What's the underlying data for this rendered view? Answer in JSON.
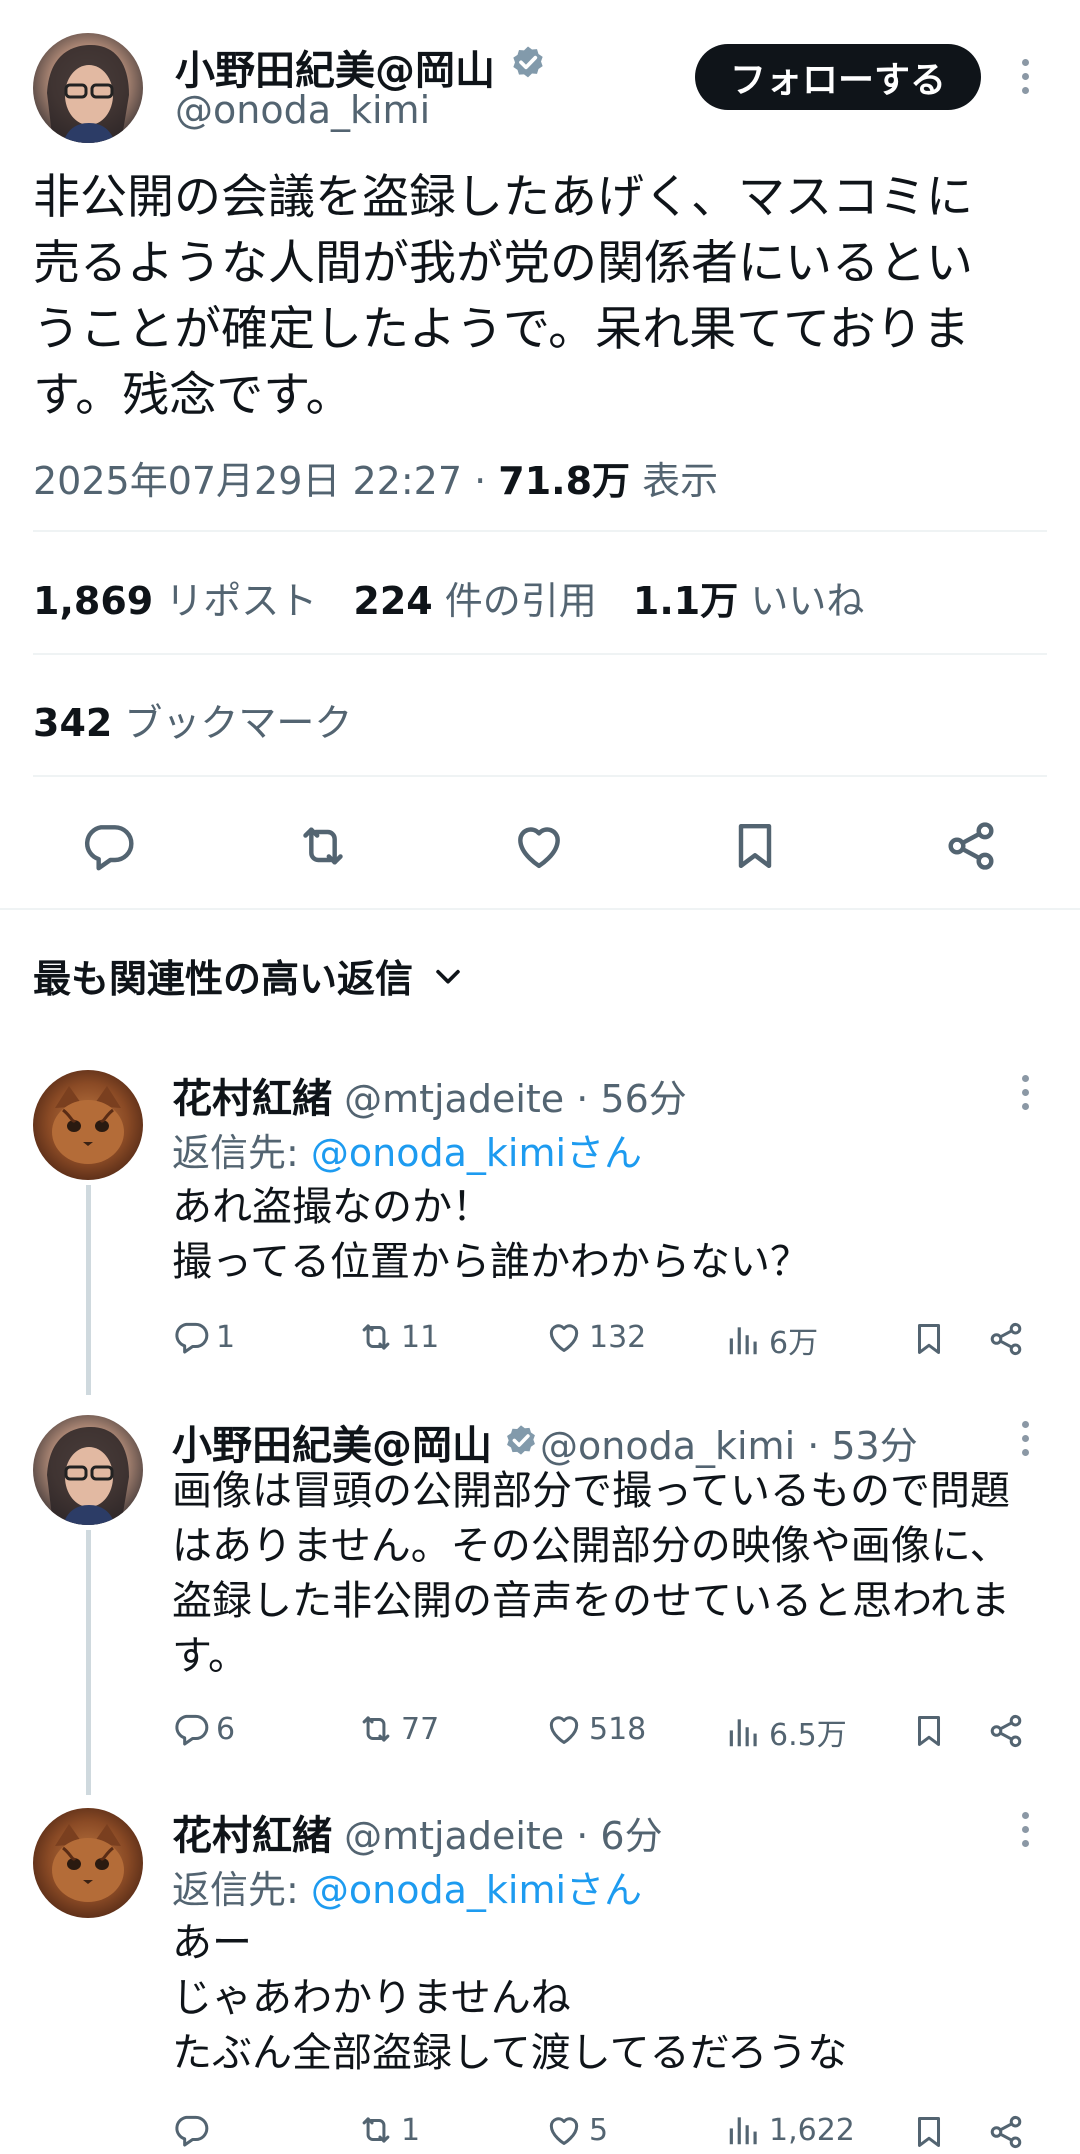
{
  "main_tweet": {
    "author_name": "小野田紀美@岡山",
    "author_handle": "@onoda_kimi",
    "follow_label": "フォローする",
    "text_lines": [
      "非公開の会議を盗録したあげく、マスコミに",
      "売るような人間が我が党の関係者にいるとい",
      "うことが確定したようで。呆れ果てておりま",
      "す。残念です。"
    ],
    "timestamp": "2025年07月29日 22:27 · ",
    "views_count": "71.8万",
    "views_label": " 表示",
    "stats": {
      "reposts_count": "1,869",
      "reposts_label": " リポスト",
      "quotes_count": "224",
      "quotes_label": " 件の引用",
      "likes_count": "1.1万",
      "likes_label": " いいね",
      "bookmarks_count": "342",
      "bookmarks_label": " ブックマーク"
    }
  },
  "replies_header": "最も関連性の高い返信",
  "replies": [
    {
      "name": "花村紅緒",
      "meta": " @mtjadeite · 56分",
      "reply_to_prefix": "返信先: ",
      "reply_to_handle": "@onoda_kimiさん",
      "lines": [
        "あれ盗撮なのか！",
        "撮ってる位置から誰かわからない？"
      ],
      "replies": "1",
      "reposts": "11",
      "likes": "132",
      "views": "6万"
    },
    {
      "name": "小野田紀美@岡山",
      "meta": " @onoda_kimi · 53分",
      "lines": [
        "画像は冒頭の公開部分で撮っているもので問題",
        "はありません。その公開部分の映像や画像に、",
        "盗録した非公開の音声をのせていると思われま",
        "す。"
      ],
      "replies": "6",
      "reposts": "77",
      "likes": "518",
      "views": "6.5万"
    },
    {
      "name": "花村紅緒",
      "meta": " @mtjadeite · 6分",
      "reply_to_prefix": "返信先: ",
      "reply_to_handle": "@onoda_kimiさん",
      "lines": [
        "あー",
        "じゃあわかりませんね",
        "たぶん全部盗録して渡してるだろうな"
      ],
      "replies": "",
      "reposts": "1",
      "likes": "5",
      "views": "1,622"
    }
  ],
  "colors": {
    "accent": "#1d9bf0",
    "text": "#0f1419",
    "secondary": "#536471",
    "verified": "#829aab"
  }
}
